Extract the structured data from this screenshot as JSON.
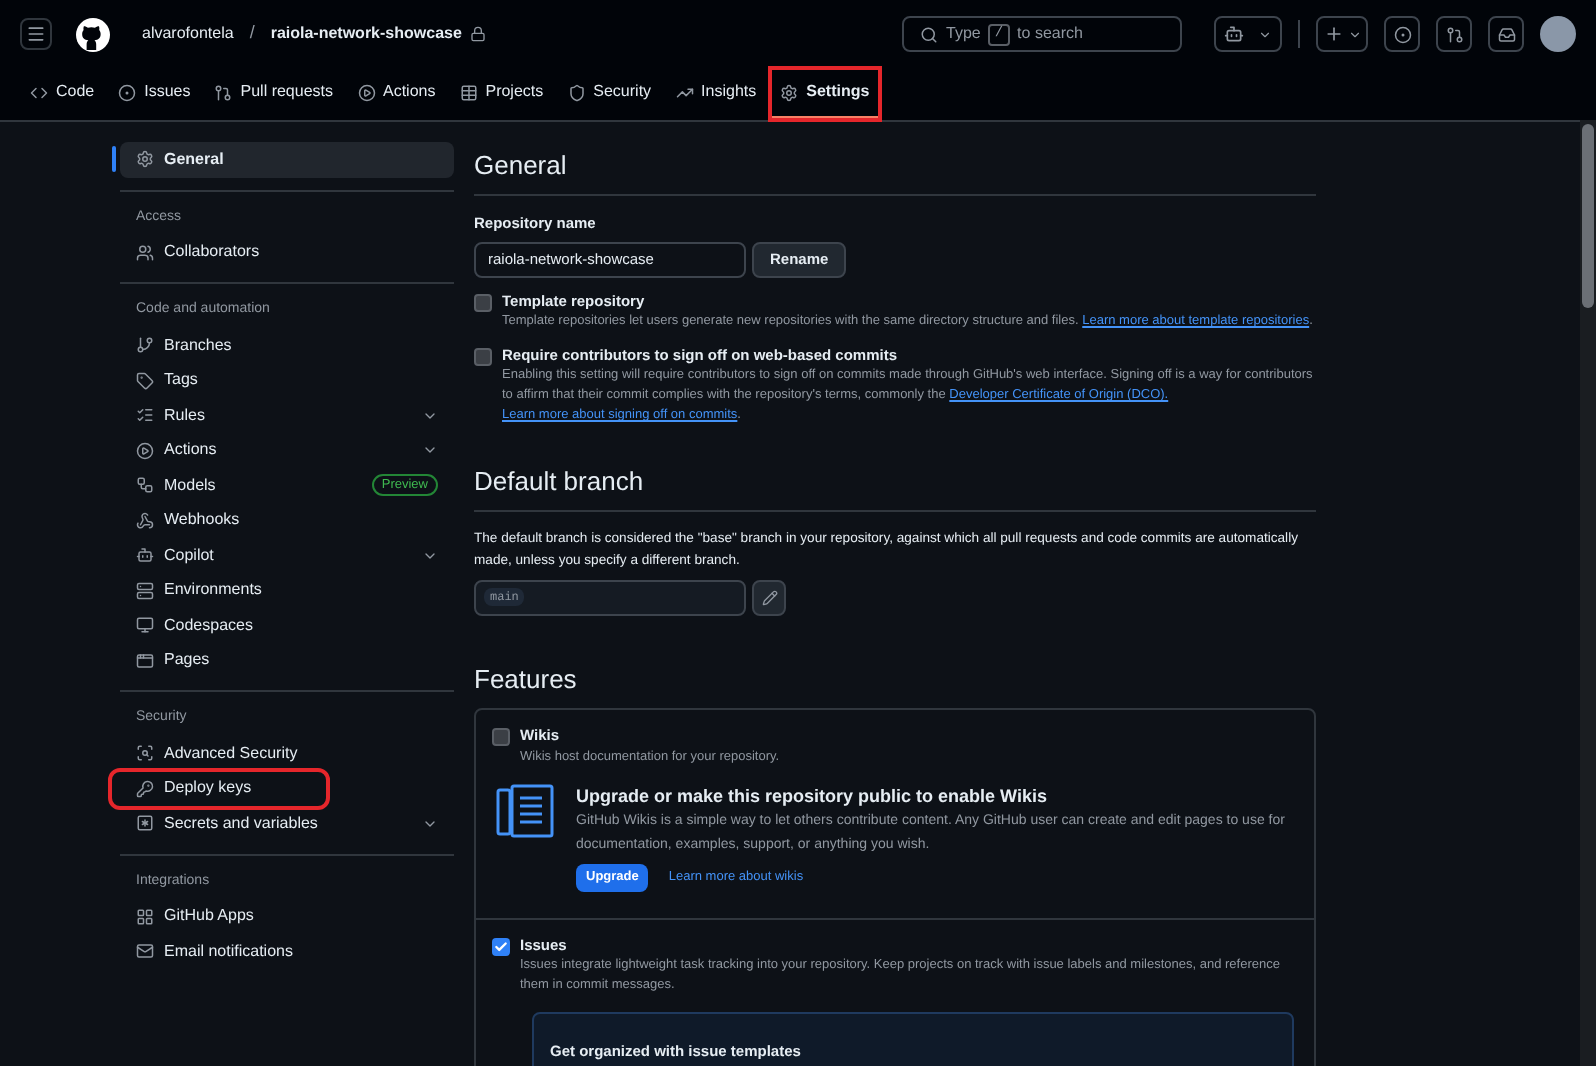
{
  "header": {
    "owner": "alvarofontela",
    "separator": "/",
    "repo": "raiola-network-showcase",
    "search": {
      "before": "Type",
      "key": "/",
      "after": "to search"
    }
  },
  "tabs": [
    {
      "label": "Code",
      "selected": false,
      "highlighted": false
    },
    {
      "label": "Issues",
      "selected": false,
      "highlighted": false
    },
    {
      "label": "Pull requests",
      "selected": false,
      "highlighted": false
    },
    {
      "label": "Actions",
      "selected": false,
      "highlighted": false
    },
    {
      "label": "Projects",
      "selected": false,
      "highlighted": false
    },
    {
      "label": "Security",
      "selected": false,
      "highlighted": false
    },
    {
      "label": "Insights",
      "selected": false,
      "highlighted": false
    },
    {
      "label": "Settings",
      "selected": true,
      "highlighted": true
    }
  ],
  "sidebar": {
    "groups": [
      {
        "items": [
          {
            "label": "General",
            "selected": true,
            "expandable": false,
            "highlighted": false
          }
        ]
      },
      {
        "heading": "Access",
        "items": [
          {
            "label": "Collaborators",
            "selected": false,
            "expandable": false,
            "highlighted": false
          }
        ]
      },
      {
        "heading": "Code and automation",
        "items": [
          {
            "label": "Branches",
            "selected": false,
            "expandable": false,
            "highlighted": false
          },
          {
            "label": "Tags",
            "selected": false,
            "expandable": false,
            "highlighted": false
          },
          {
            "label": "Rules",
            "selected": false,
            "expandable": true,
            "highlighted": false
          },
          {
            "label": "Actions",
            "selected": false,
            "expandable": true,
            "highlighted": false
          },
          {
            "label": "Models",
            "selected": false,
            "expandable": false,
            "highlighted": false,
            "badge": "Preview"
          },
          {
            "label": "Webhooks",
            "selected": false,
            "expandable": false,
            "highlighted": false
          },
          {
            "label": "Copilot",
            "selected": false,
            "expandable": true,
            "highlighted": false
          },
          {
            "label": "Environments",
            "selected": false,
            "expandable": false,
            "highlighted": false
          },
          {
            "label": "Codespaces",
            "selected": false,
            "expandable": false,
            "highlighted": false
          },
          {
            "label": "Pages",
            "selected": false,
            "expandable": false,
            "highlighted": false
          }
        ]
      },
      {
        "heading": "Security",
        "items": [
          {
            "label": "Advanced Security",
            "selected": false,
            "expandable": false,
            "highlighted": false
          },
          {
            "label": "Deploy keys",
            "selected": false,
            "expandable": false,
            "highlighted": true
          },
          {
            "label": "Secrets and variables",
            "selected": false,
            "expandable": true,
            "highlighted": false
          }
        ]
      },
      {
        "heading": "Integrations",
        "items": [
          {
            "label": "GitHub Apps",
            "selected": false,
            "expandable": false,
            "highlighted": false
          },
          {
            "label": "Email notifications",
            "selected": false,
            "expandable": false,
            "highlighted": false
          }
        ]
      }
    ]
  },
  "general": {
    "title": "General",
    "repo_name_label": "Repository name",
    "repo_name_value": "raiola-network-showcase",
    "rename_button": "Rename",
    "options": [
      {
        "title": "Template repository",
        "checked": false,
        "description": "Template repositories let users generate new repositories with the same directory structure and files.",
        "links": [
          "Learn more about template repositories"
        ],
        "tail": "."
      },
      {
        "title": "Require contributors to sign off on web-based commits",
        "checked": false,
        "description": "Enabling this setting will require contributors to sign off on commits made through GitHub's web interface. Signing off is a way for contributors to affirm that their commit complies with the repository's terms, commonly the",
        "links": [
          "Developer Certificate of Origin (DCO).",
          "Learn more about signing off on commits"
        ],
        "tail": "."
      }
    ]
  },
  "default_branch": {
    "title": "Default branch",
    "description": "The default branch is considered the \"base\" branch in your repository, against which all pull requests and code commits are automatically made, unless you specify a different branch.",
    "branch": "main"
  },
  "features": {
    "title": "Features",
    "items": [
      {
        "title": "Wikis",
        "checked": false,
        "description": "Wikis host documentation for your repository.",
        "upsell": {
          "title": "Upgrade or make this repository public to enable Wikis",
          "text": "GitHub Wikis is a simple way to let others contribute content. Any GitHub user can create and edit pages to use for documentation, examples, support, or anything you wish.",
          "button": "Upgrade",
          "link": "Learn more about wikis"
        }
      },
      {
        "title": "Issues",
        "checked": true,
        "description": "Issues integrate lightweight task tracking into your repository. Keep projects on track with issue labels and milestones, and reference them in commit messages.",
        "card_title": "Get organized with issue templates"
      }
    ]
  }
}
